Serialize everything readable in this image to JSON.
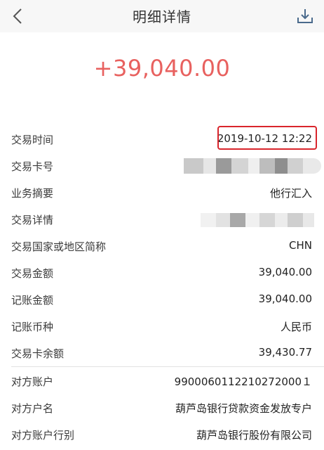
{
  "header": {
    "title": "明细详情",
    "back_icon": "chevron-left-icon",
    "download_icon": "download-icon"
  },
  "amount": "+39,040.00",
  "details": {
    "time": {
      "label": "交易时间",
      "value": "2019-10-12 12:22"
    },
    "card_no": {
      "label": "交易卡号"
    },
    "summary": {
      "label": "业务摘要",
      "value": "他行汇入"
    },
    "detail": {
      "label": "交易详情"
    },
    "country": {
      "label": "交易国家或地区简称",
      "value": "CHN"
    },
    "trade_amount": {
      "label": "交易金额",
      "value": "39,040.00"
    },
    "book_amount": {
      "label": "记账金额",
      "value": "39,040.00"
    },
    "currency": {
      "label": "记账币种",
      "value": "人民币"
    },
    "balance": {
      "label": "交易卡余额",
      "value": "39,430.77"
    }
  },
  "counterparty": {
    "account": {
      "label": "对方账户",
      "value": "9900060112210272000１"
    },
    "name": {
      "label": "对方户名",
      "value": "葫芦岛银行贷款资金发放专户"
    },
    "bank": {
      "label": "对方账户行别",
      "value": "葫芦岛银行股份有限公司"
    }
  },
  "colors": {
    "amount": "#e8615f",
    "highlight_border": "#d9252c",
    "header_bg": "#f7f7f7"
  }
}
